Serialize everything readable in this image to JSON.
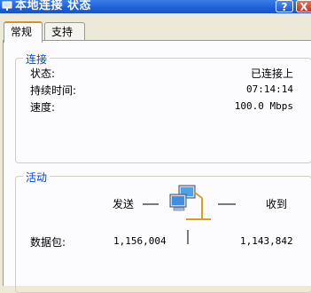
{
  "window": {
    "title": "本地连接 状态",
    "help_label": "?",
    "close_label": "X"
  },
  "tabs": [
    {
      "label": "常规",
      "active": true
    },
    {
      "label": "支持",
      "active": false
    }
  ],
  "connection": {
    "title": "连接",
    "rows": [
      {
        "label": "状态:",
        "value": "已连接上"
      },
      {
        "label": "持续时间:",
        "value": "07:14:14"
      },
      {
        "label": "速度:",
        "value": "100.0 Mbps"
      }
    ]
  },
  "activity": {
    "title": "活动",
    "sent_label": "发送",
    "received_label": "收到",
    "packets_label": "数据包:",
    "packets_sent": "1,156,004",
    "packets_received": "1,143,842",
    "icon": "network-computers-icon"
  }
}
